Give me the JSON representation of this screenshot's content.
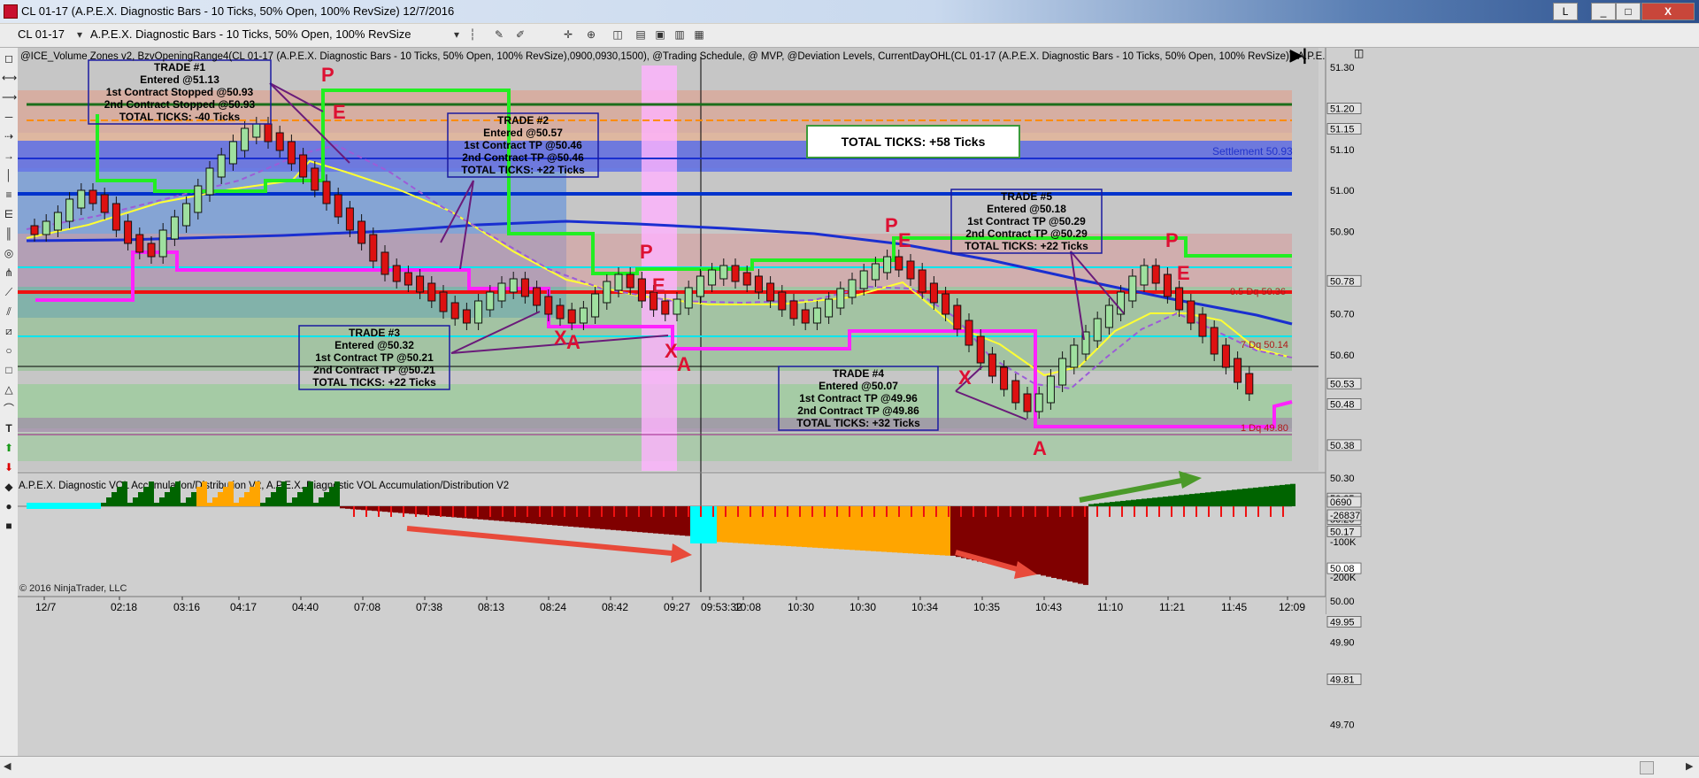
{
  "window": {
    "title": "CL 01-17 (A.P.E.X. Diagnostic Bars - 10 Ticks, 50% Open, 100% RevSize)  12/7/2016",
    "min": "_",
    "max": "□",
    "close": "X",
    "extra": "L"
  },
  "toolbar": {
    "instrument": "CL 01-17",
    "bar_type": "A.P.E.X. Diagnostic Bars - 10 Ticks, 50% Open, 100% RevSize"
  },
  "chart": {
    "indicator_header": "@ICE_Volume Zones v2, BzvOpeningRange4(CL 01-17 (A.P.E.X. Diagnostic Bars - 10 Ticks, 50% Open, 100% RevSize),0900,0930,1500), @Trading Schedule, @ MVP, @Deviation Levels, CurrentDayOHL(CL 01-17 (A.P.E.X. Diagnostic Bars - 10 Ticks, 50% Open, 100% RevSize)), A.P.E.X. Diag",
    "lower_header": "A.P.E.X. Diagnostic VOL Accumulation/Distribution V2, A.P.E.X. Diagnostic VOL Accumulation/Distribution V2",
    "copyright": "© 2016 NinjaTrader, LLC",
    "settlement_label": "Settlement 50.93",
    "dev_label_1": "0.5 Dq 50.36",
    "dev_label_2": "7 Dq 50.14",
    "dev_label_3": "1 Dq 49.80",
    "total_ticks": "TOTAL TICKS: +58 Ticks",
    "price_axis": [
      "51.30",
      "51.20",
      "51.15",
      "51.10",
      "51.00",
      "50.90",
      "50.78",
      "50.70",
      "50.60",
      "50.53",
      "50.48",
      "50.38",
      "50.30",
      "50.25",
      "50.20",
      "50.17",
      "50.08",
      "50.00",
      "49.95",
      "49.90",
      "49.81",
      "49.70"
    ],
    "volume_axis": [
      "0690",
      "-26837",
      "-100K",
      "-200K"
    ],
    "time_axis": [
      "12/7",
      "02:18",
      "03:16",
      "04:17",
      "04:40",
      "07:08",
      "07:38",
      "08:13",
      "08:24",
      "08:42",
      "09:27",
      "09:53:32",
      "10:08",
      "10:30",
      "10:30",
      "10:34",
      "10:35",
      "10:43",
      "11:10",
      "11:21",
      "11:45",
      "12:09"
    ],
    "markers": [
      "P",
      "E",
      "P",
      "E",
      "P",
      "E",
      "P",
      "E",
      "X",
      "A",
      "X",
      "A",
      "X",
      "A"
    ],
    "trades": [
      {
        "title": "TRADE #1",
        "lines": [
          "Entered @51.13",
          "1st Contract Stopped @50.93",
          "2nd Contract Stopped @50.93",
          "TOTAL TICKS: -40 Ticks"
        ]
      },
      {
        "title": "TRADE #2",
        "lines": [
          "Entered @50.57",
          "1st Contract TP @50.46",
          "2nd Contract TP @50.46",
          "TOTAL TICKS: +22 Ticks"
        ]
      },
      {
        "title": "TRADE #3",
        "lines": [
          "Entered @50.32",
          "1st Contract TP @50.21",
          "2nd Contract TP @50.21",
          "TOTAL TICKS: +22 Ticks"
        ]
      },
      {
        "title": "TRADE #4",
        "lines": [
          "Entered @50.07",
          "1st Contract TP @49.96",
          "2nd Contract TP @49.86",
          "TOTAL TICKS: +32 Ticks"
        ]
      },
      {
        "title": "TRADE #5",
        "lines": [
          "Entered @50.18",
          "1st Contract TP @50.29",
          "2nd Contract TP @50.29",
          "TOTAL TICKS: +22 Ticks"
        ]
      }
    ]
  },
  "colors": {
    "up_bar": "#9fe09f",
    "down_bar": "#dd1111",
    "accum": "#006400",
    "distrib": "#800000",
    "orange_zone": "#ffa500",
    "cyan": "#00ffff",
    "magenta": "#ff22ff",
    "green_line": "#22ee22",
    "blue_line": "#1a2fd0"
  }
}
